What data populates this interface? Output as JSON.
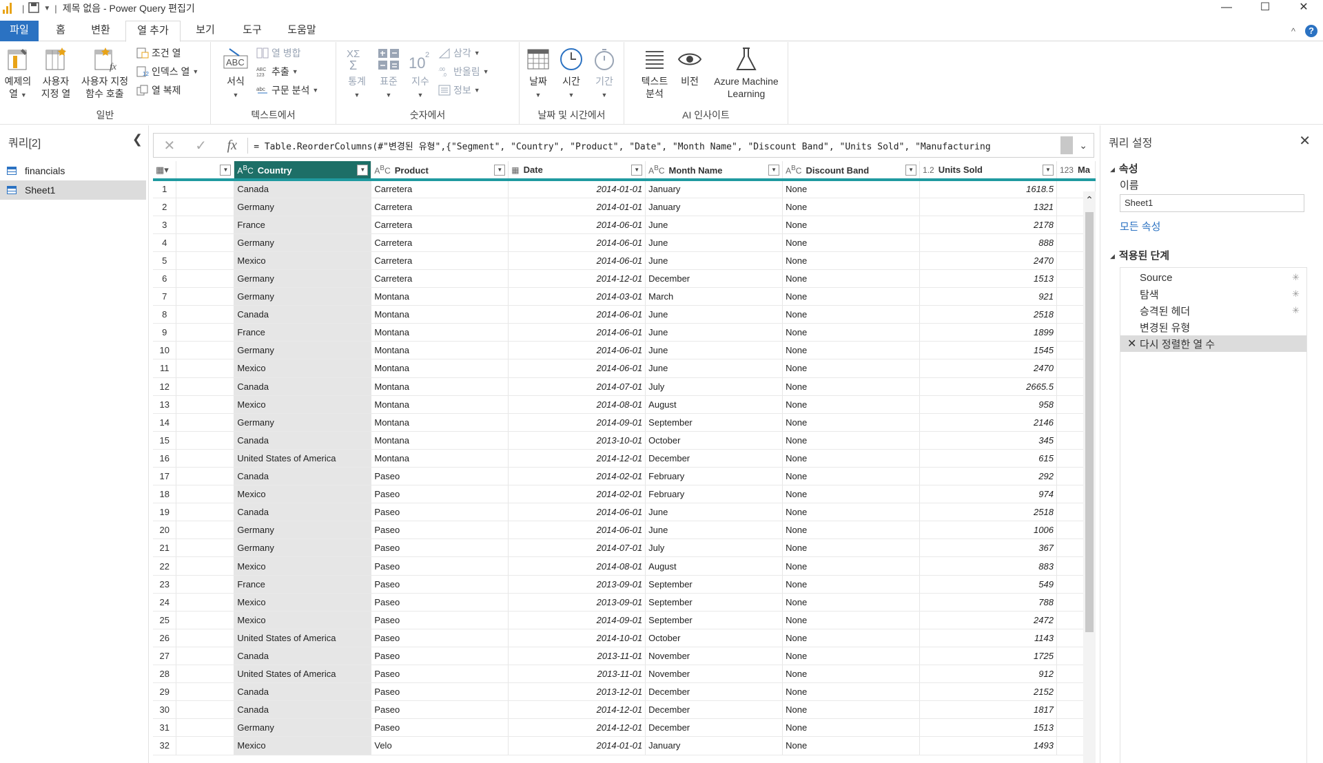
{
  "titlebar": {
    "title": "제목 없음 - Power Query 편집기",
    "controls": {
      "minimize": "—",
      "maximize": "☐",
      "close": "✕"
    }
  },
  "tabs": [
    {
      "label": "파일"
    },
    {
      "label": "홈"
    },
    {
      "label": "변환"
    },
    {
      "label": "열 추가"
    },
    {
      "label": "보기"
    },
    {
      "label": "도구"
    },
    {
      "label": "도움말"
    }
  ],
  "ribbon": {
    "general": {
      "group_label": "일반",
      "example_col": [
        "예제의",
        "열"
      ],
      "custom_col": [
        "사용자",
        "지정 열"
      ],
      "invoke_custom_fn": [
        "사용자 지정",
        "함수 호출"
      ],
      "conditional_col": "조건 열",
      "index_col": "인덱스 열",
      "duplicate_col": "열 복제"
    },
    "text": {
      "group_label": "텍스트에서",
      "format": "서식",
      "merge_cols": "열 병합",
      "extract": "추출",
      "parse": "구문 분석"
    },
    "number": {
      "group_label": "숫자에서",
      "statistics": "통계",
      "standard": "표준",
      "scientific": "지수",
      "trigonometry": "삼각",
      "rounding": "반올림",
      "information": "정보"
    },
    "datetime": {
      "group_label": "날짜 및 시간에서",
      "date": "날짜",
      "time": "시간",
      "duration": "기간"
    },
    "ai": {
      "group_label": "AI 인사이트",
      "text_analytics": [
        "텍스트",
        "분석"
      ],
      "vision": "비전",
      "azure_ml": [
        "Azure Machine",
        "Learning"
      ]
    }
  },
  "queries": {
    "header": "쿼리[2]",
    "items": [
      {
        "label": "financials",
        "selected": false
      },
      {
        "label": "Sheet1",
        "selected": true
      }
    ]
  },
  "formula": {
    "text": "= Table.ReorderColumns(#\"변경된 유형\",{\"Segment\", \"Country\", \"Product\", \"Date\", \"Month Name\", \"Discount Band\", \"Units Sold\", \"Manufacturing"
  },
  "grid": {
    "columns": [
      {
        "name": "",
        "type": ""
      },
      {
        "name": "Country",
        "type": "ABC"
      },
      {
        "name": "Product",
        "type": "ABC"
      },
      {
        "name": "Date",
        "type": "date"
      },
      {
        "name": "Month Name",
        "type": "ABC"
      },
      {
        "name": "Discount Band",
        "type": "ABC"
      },
      {
        "name": "Units Sold",
        "type": "1.2"
      },
      {
        "name": "Ma",
        "type": "123"
      }
    ],
    "rows": [
      [
        "1",
        "Canada",
        "Carretera",
        "2014-01-01",
        "January",
        "None",
        "1618.5"
      ],
      [
        "2",
        "Germany",
        "Carretera",
        "2014-01-01",
        "January",
        "None",
        "1321"
      ],
      [
        "3",
        "France",
        "Carretera",
        "2014-06-01",
        "June",
        "None",
        "2178"
      ],
      [
        "4",
        "Germany",
        "Carretera",
        "2014-06-01",
        "June",
        "None",
        "888"
      ],
      [
        "5",
        "Mexico",
        "Carretera",
        "2014-06-01",
        "June",
        "None",
        "2470"
      ],
      [
        "6",
        "Germany",
        "Carretera",
        "2014-12-01",
        "December",
        "None",
        "1513"
      ],
      [
        "7",
        "Germany",
        "Montana",
        "2014-03-01",
        "March",
        "None",
        "921"
      ],
      [
        "8",
        "Canada",
        "Montana",
        "2014-06-01",
        "June",
        "None",
        "2518"
      ],
      [
        "9",
        "France",
        "Montana",
        "2014-06-01",
        "June",
        "None",
        "1899"
      ],
      [
        "10",
        "Germany",
        "Montana",
        "2014-06-01",
        "June",
        "None",
        "1545"
      ],
      [
        "11",
        "Mexico",
        "Montana",
        "2014-06-01",
        "June",
        "None",
        "2470"
      ],
      [
        "12",
        "Canada",
        "Montana",
        "2014-07-01",
        "July",
        "None",
        "2665.5"
      ],
      [
        "13",
        "Mexico",
        "Montana",
        "2014-08-01",
        "August",
        "None",
        "958"
      ],
      [
        "14",
        "Germany",
        "Montana",
        "2014-09-01",
        "September",
        "None",
        "2146"
      ],
      [
        "15",
        "Canada",
        "Montana",
        "2013-10-01",
        "October",
        "None",
        "345"
      ],
      [
        "16",
        "United States of America",
        "Montana",
        "2014-12-01",
        "December",
        "None",
        "615"
      ],
      [
        "17",
        "Canada",
        "Paseo",
        "2014-02-01",
        "February",
        "None",
        "292"
      ],
      [
        "18",
        "Mexico",
        "Paseo",
        "2014-02-01",
        "February",
        "None",
        "974"
      ],
      [
        "19",
        "Canada",
        "Paseo",
        "2014-06-01",
        "June",
        "None",
        "2518"
      ],
      [
        "20",
        "Germany",
        "Paseo",
        "2014-06-01",
        "June",
        "None",
        "1006"
      ],
      [
        "21",
        "Germany",
        "Paseo",
        "2014-07-01",
        "July",
        "None",
        "367"
      ],
      [
        "22",
        "Mexico",
        "Paseo",
        "2014-08-01",
        "August",
        "None",
        "883"
      ],
      [
        "23",
        "France",
        "Paseo",
        "2013-09-01",
        "September",
        "None",
        "549"
      ],
      [
        "24",
        "Mexico",
        "Paseo",
        "2013-09-01",
        "September",
        "None",
        "788"
      ],
      [
        "25",
        "Mexico",
        "Paseo",
        "2014-09-01",
        "September",
        "None",
        "2472"
      ],
      [
        "26",
        "United States of America",
        "Paseo",
        "2014-10-01",
        "October",
        "None",
        "1143"
      ],
      [
        "27",
        "Canada",
        "Paseo",
        "2013-11-01",
        "November",
        "None",
        "1725"
      ],
      [
        "28",
        "United States of America",
        "Paseo",
        "2013-11-01",
        "November",
        "None",
        "912"
      ],
      [
        "29",
        "Canada",
        "Paseo",
        "2013-12-01",
        "December",
        "None",
        "2152"
      ],
      [
        "30",
        "Canada",
        "Paseo",
        "2014-12-01",
        "December",
        "None",
        "1817"
      ],
      [
        "31",
        "Germany",
        "Paseo",
        "2014-12-01",
        "December",
        "None",
        "1513"
      ],
      [
        "32",
        "Mexico",
        "Velo",
        "2014-01-01",
        "January",
        "None",
        "1493"
      ]
    ]
  },
  "settings": {
    "header": "쿼리 설정",
    "properties_title": "속성",
    "name_label": "이름",
    "name_value": "Sheet1",
    "all_properties": "모든 속성",
    "steps_title": "적용된 단계",
    "steps": [
      {
        "label": "Source",
        "gear": true,
        "selected": false
      },
      {
        "label": "탐색",
        "gear": true,
        "selected": false
      },
      {
        "label": "승격된 헤더",
        "gear": true,
        "selected": false
      },
      {
        "label": "변경된 유형",
        "gear": false,
        "selected": false
      },
      {
        "label": "다시 정렬한 열 수",
        "gear": false,
        "selected": true
      }
    ]
  },
  "colors": {
    "accent": "#2b72c2",
    "selected_header": "#1d6f67",
    "quality_bar": "#1f9aa0"
  }
}
